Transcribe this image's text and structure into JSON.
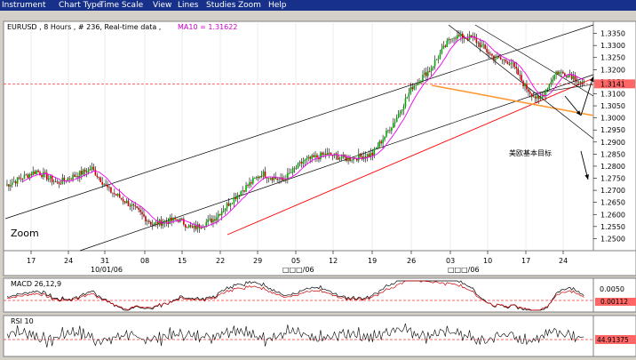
{
  "menu": [
    "Instrument",
    "Chart Type",
    "Time Scale",
    "View",
    "Lines",
    "Studies",
    "Zoom",
    "Help"
  ],
  "chart_data": [
    {
      "type": "candlestick",
      "header": "EURUSD , 8 Hours , # 236, Real-time data ,",
      "indicator_label": "MA10 = 1.31622",
      "zoom_label": "Zoom",
      "annotation": "美欧基本目标",
      "price_marker": "1.3141",
      "ylim": [
        1.245,
        1.34
      ],
      "yticks": [
        "1.3350",
        "1.3300",
        "1.3250",
        "1.3200",
        "1.3150",
        "1.3100",
        "1.3050",
        "1.3000",
        "1.2950",
        "1.2900",
        "1.2850",
        "1.2800",
        "1.2750",
        "1.2700",
        "1.2650",
        "1.2600",
        "1.2550",
        "1.2500"
      ],
      "xticks": [
        "17",
        "24",
        "31",
        "08",
        "15",
        "22",
        "29",
        "05",
        "12",
        "19",
        "26",
        "03",
        "10",
        "17",
        "24"
      ],
      "xlabels_month": [
        "10/01/06",
        "□□□/06",
        "□□□/06"
      ],
      "key_points": [
        {
          "bar": 0,
          "price": 1.272
        },
        {
          "bar": 18,
          "price": 1.278
        },
        {
          "bar": 30,
          "price": 1.273
        },
        {
          "bar": 50,
          "price": 1.279
        },
        {
          "bar": 60,
          "price": 1.27
        },
        {
          "bar": 72,
          "price": 1.264
        },
        {
          "bar": 85,
          "price": 1.256
        },
        {
          "bar": 100,
          "price": 1.258
        },
        {
          "bar": 108,
          "price": 1.254
        },
        {
          "bar": 120,
          "price": 1.258
        },
        {
          "bar": 135,
          "price": 1.269
        },
        {
          "bar": 148,
          "price": 1.277
        },
        {
          "bar": 160,
          "price": 1.274
        },
        {
          "bar": 172,
          "price": 1.282
        },
        {
          "bar": 185,
          "price": 1.285
        },
        {
          "bar": 198,
          "price": 1.283
        },
        {
          "bar": 212,
          "price": 1.285
        },
        {
          "bar": 225,
          "price": 1.299
        },
        {
          "bar": 235,
          "price": 1.313
        },
        {
          "bar": 245,
          "price": 1.32
        },
        {
          "bar": 258,
          "price": 1.334
        },
        {
          "bar": 270,
          "price": 1.333
        },
        {
          "bar": 282,
          "price": 1.325
        },
        {
          "bar": 292,
          "price": 1.323
        },
        {
          "bar": 300,
          "price": 1.313
        },
        {
          "bar": 308,
          "price": 1.307
        },
        {
          "bar": 318,
          "price": 1.319
        },
        {
          "bar": 326,
          "price": 1.318
        },
        {
          "bar": 334,
          "price": 1.314
        }
      ]
    },
    {
      "type": "line",
      "label": "MACD 26,12,9",
      "ticks": [
        "0.0050"
      ],
      "readout": "0.00112"
    },
    {
      "type": "line",
      "label": "RSI 10",
      "readout": "44.91375"
    }
  ]
}
